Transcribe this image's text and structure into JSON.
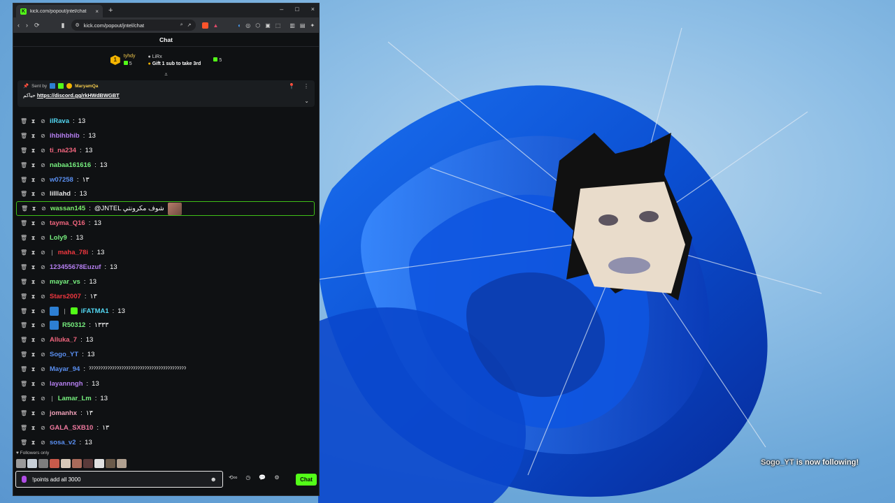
{
  "browser": {
    "tab_title": "kick.com/popout/jntel/chat",
    "new_tab": "+",
    "close_tab": "×",
    "window_controls": [
      "–",
      "□",
      "×"
    ],
    "url": "kick.com/popout/jntel/chat"
  },
  "chat": {
    "title": "Chat",
    "leaderboard": {
      "first_rank": "1",
      "first_name": "tyhdy",
      "first_count": "5",
      "second_name": "LiRx",
      "gift_line": "Gift 1 sub to take 3rd",
      "third_count": "5"
    },
    "pinned": {
      "sent_by": "Sent by",
      "author": "MaryamQa",
      "prefix": "حياكم",
      "link": "https://discord.gg/rkHWdBWGBT"
    },
    "messages": [
      {
        "user": "ilRava",
        "text": "13",
        "color": "#53d8f3"
      },
      {
        "user": "ihbihbhib",
        "text": "13",
        "color": "#b57ff0"
      },
      {
        "user": "ti_na234",
        "text": "13",
        "color": "#f0657d"
      },
      {
        "user": "nabaa161616",
        "text": "13",
        "color": "#77f07f"
      },
      {
        "user": "w07258",
        "text": "١٣",
        "color": "#5a8ff0"
      },
      {
        "user": "lilllahd",
        "text": "13",
        "color": "#e4e4e4"
      },
      {
        "user": "wassan145",
        "text": "@JNTEL شوف مكرونتي",
        "color": "#7df06e"
      },
      {
        "user": "tayma_Q16",
        "text": "13",
        "color": "#f0657d"
      },
      {
        "user": "Loly9",
        "text": "13",
        "color": "#77f07f"
      },
      {
        "user": "maha_78i",
        "text": "13",
        "color": "#f0373f"
      },
      {
        "user": "123455678Euzuf",
        "text": "13",
        "color": "#b57ff0"
      },
      {
        "user": "mayar_vs",
        "text": "13",
        "color": "#77f07f"
      },
      {
        "user": "Stars2007",
        "text": "١٣",
        "color": "#f0373f"
      },
      {
        "user": "iFATMA1",
        "text": "13",
        "color": "#53d8f3"
      },
      {
        "user": "R50312",
        "text": "١٣٣٣",
        "color": "#77f07f"
      },
      {
        "user": "Alluka_7",
        "text": "13",
        "color": "#f0657d"
      },
      {
        "user": "Sogo_YT",
        "text": "13",
        "color": "#5a8ff0"
      },
      {
        "user": "Mayar_94",
        "text": "ˀˀˀˀˀˀˀˀˀˀˀˀˀˀˀˀˀˀˀˀˀˀˀˀˀˀˀˀˀˀˀˀˀˀˀˀˀˀˀˀˀˀ",
        "color": "#5a8ff0"
      },
      {
        "user": "layannngh",
        "text": "13",
        "color": "#b57ff0"
      },
      {
        "user": "Lamar_Lm",
        "text": "13",
        "color": "#77f07f"
      },
      {
        "user": "jomanhx",
        "text": "١٣",
        "color": "#f0a0b8"
      },
      {
        "user": "GALA_SXB10",
        "text": "١٣",
        "color": "#f07aa0"
      },
      {
        "user": "sosa_v2",
        "text": "13",
        "color": "#5a8ff0"
      }
    ],
    "followers_only": "Followers only",
    "input_value": "!points add all 3000",
    "send_label": "Chat"
  },
  "desktop": {
    "toast_user": "Sogo_YT",
    "toast_text": " is now following!"
  },
  "colors": {
    "kick_green": "#53fc18",
    "bg": "#0f1113"
  }
}
